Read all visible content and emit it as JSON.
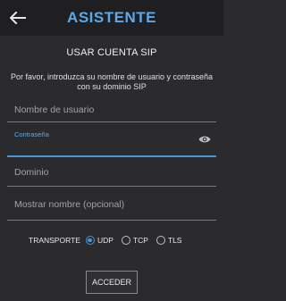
{
  "header": {
    "title": "ASISTENTE",
    "back_icon": "arrow-left-icon"
  },
  "form": {
    "heading": "USAR CUENTA SIP",
    "description": "Por favor, introduzca su nombre de usuario y contraseña con su dominio SIP",
    "username": {
      "placeholder": "Nombre de usuario",
      "value": ""
    },
    "password": {
      "label": "Contraseña",
      "value": "",
      "toggle_icon": "eye-icon"
    },
    "domain": {
      "placeholder": "Dominio",
      "value": ""
    },
    "display_name": {
      "placeholder": "Mostrar nombre (opcional)",
      "value": ""
    }
  },
  "transport": {
    "label": "TRANSPORTE",
    "options": [
      {
        "label": "UDP",
        "selected": true
      },
      {
        "label": "TCP",
        "selected": false
      },
      {
        "label": "TLS",
        "selected": false
      }
    ]
  },
  "submit_label": "ACCEDER",
  "colors": {
    "accent": "#4a95d6",
    "background": "#2b2b2e",
    "topbar": "#1f1f22"
  }
}
